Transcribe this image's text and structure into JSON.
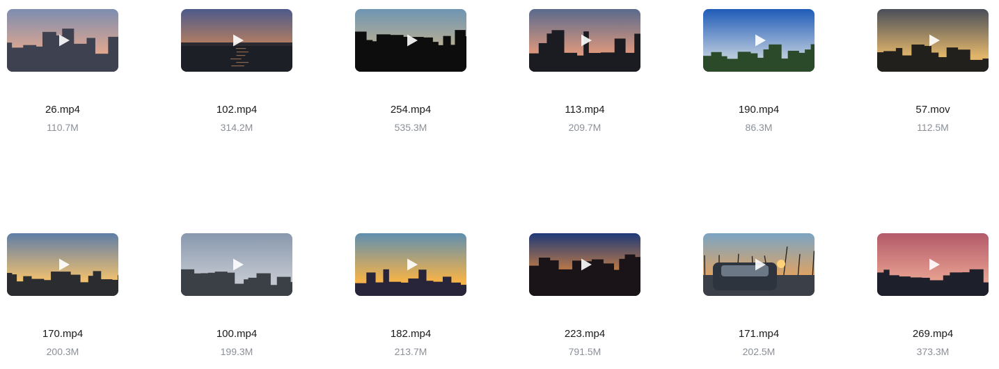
{
  "videos": [
    {
      "name": "26.mp4",
      "size": "110.7M",
      "sky_top": "#7d8db0",
      "sky_bottom": "#e7a98c",
      "ground": "#3e4150",
      "skyline": "towers"
    },
    {
      "name": "102.mp4",
      "size": "314.2M",
      "sky_top": "#4d5a8a",
      "sky_bottom": "#d58a55",
      "ground": "#1c1f26",
      "skyline": "water"
    },
    {
      "name": "254.mp4",
      "size": "535.3M",
      "sky_top": "#6f95b3",
      "sky_bottom": "#c9b48c",
      "ground": "#0d0d0d",
      "skyline": "silhouette"
    },
    {
      "name": "113.mp4",
      "size": "209.7M",
      "sky_top": "#5a6a8c",
      "sky_bottom": "#e49a7c",
      "ground": "#1b1b22",
      "skyline": "towers"
    },
    {
      "name": "190.mp4",
      "size": "86.3M",
      "sky_top": "#1f5bb8",
      "sky_bottom": "#b6c7dc",
      "ground": "#2b4a2a",
      "skyline": "city"
    },
    {
      "name": "57.mov",
      "size": "112.5M",
      "sky_top": "#4a4f5a",
      "sky_bottom": "#e0b46a",
      "ground": "#22201c",
      "skyline": "city"
    },
    {
      "name": "170.mp4",
      "size": "200.3M",
      "sky_top": "#5f7da6",
      "sky_bottom": "#f0c070",
      "ground": "#2a2c30",
      "skyline": "city"
    },
    {
      "name": "100.mp4",
      "size": "199.3M",
      "sky_top": "#8898ad",
      "sky_bottom": "#c2c7cf",
      "ground": "#3b4046",
      "skyline": "city"
    },
    {
      "name": "182.mp4",
      "size": "213.7M",
      "sky_top": "#5f8fb0",
      "sky_bottom": "#f3b24a",
      "ground": "#28243a",
      "skyline": "city"
    },
    {
      "name": "223.mp4",
      "size": "791.5M",
      "sky_top": "#1e3a78",
      "sky_bottom": "#e68a3a",
      "ground": "#1a1418",
      "skyline": "silhouette"
    },
    {
      "name": "171.mp4",
      "size": "202.5M",
      "sky_top": "#7aa4c4",
      "sky_bottom": "#e9a35a",
      "ground": "#2c3038",
      "skyline": "car"
    },
    {
      "name": "269.mp4",
      "size": "373.3M",
      "sky_top": "#b35a6a",
      "sky_bottom": "#e7a090",
      "ground": "#1d1f2a",
      "skyline": "city"
    }
  ],
  "icons": {
    "play": "play-icon"
  }
}
